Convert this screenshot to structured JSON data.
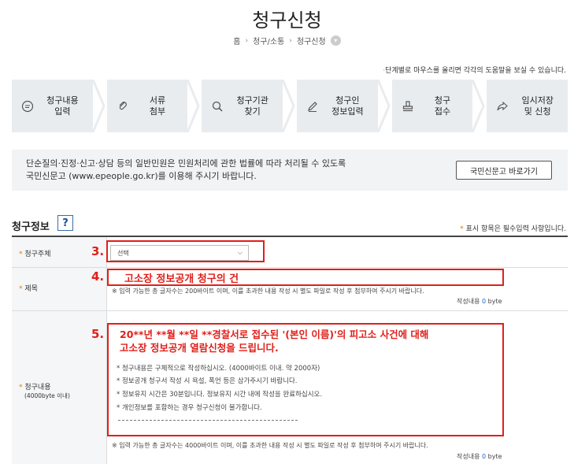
{
  "header": {
    "title": "청구신청",
    "breadcrumb": [
      "홈",
      "청구/소통",
      "청구신청"
    ]
  },
  "help_note": "단계별로 마우스를 올리면 각각의 도움말을 보실 수 있습니다.",
  "steps": [
    {
      "label": "청구내용\n입력",
      "icon": "chat-bubble-icon"
    },
    {
      "label": "서류\n첨부",
      "icon": "paperclip-icon"
    },
    {
      "label": "청구기관\n찾기",
      "icon": "search-icon"
    },
    {
      "label": "청구인\n정보입력",
      "icon": "pencil-icon"
    },
    {
      "label": "청구\n접수",
      "icon": "stamp-icon"
    },
    {
      "label": "임시저장\n및 신청",
      "icon": "share-arrow-icon"
    }
  ],
  "notice": {
    "line1": "단순질의·진정·신고·상담 등의 일반민원은 민원처리에 관한 법률에 따라 처리될 수 있도록",
    "line2": "국민신문고 (www.epeople.go.kr)를 이용해 주시기 바랍니다.",
    "button": "국민신문고 바로가기"
  },
  "section": {
    "title": "청구정보",
    "help": "?",
    "required_note": "표시 항목은 필수입력 사항입니다."
  },
  "form": {
    "subject": {
      "label": "청구주체",
      "value": "선택",
      "annotation": "3."
    },
    "title": {
      "label": "제목",
      "value": "고소장 정보공개 청구의 건",
      "annotation": "4.",
      "note": "※ 입력 가능한 총 글자수는 200바이트 이며, 이를 초과한 내용 작성 시 별도 파일로 작성 후 첨부하여 주시기 바랍니다.",
      "counter_prefix": "작성내용",
      "counter_value": "0",
      "counter_unit": "byte"
    },
    "content": {
      "label": "청구내용",
      "sublabel": "(4000byte 이내)",
      "annotation": "5.",
      "value_line1": "20**년 **월 **일 **경찰서로 접수된 '(본인 이름)'의 피고소 사건에 대해",
      "value_line2": "고소장 정보공개 열람신청을 드립니다.",
      "guides": [
        "* 청구내용은 구체적으로 작성하십시오. (4000바이트 이내. 약 2000자)",
        "* 정보공개 청구서 작성 시 욕설, 폭언 등은 삼가주시기 바랍니다.",
        "* 정보유지 시간은 30분입니다. 정보유지 시간 내에 작성을 완료하십시오.",
        "* 개인정보를 포함하는 경우 청구신청이 불가합니다."
      ],
      "note": "※ 입력 가능한 총 글자수는 4000바이트 이며, 이를 초과한 내용 작성 시 별도 파일로 작성 후 첨부하여 주시기 바랍니다.",
      "counter_prefix": "작성내용",
      "counter_value": "0",
      "counter_unit": "byte"
    }
  },
  "colors": {
    "annotation_red": "#e0201a",
    "required_star": "#e07a00",
    "link_blue": "#1d66c9"
  }
}
